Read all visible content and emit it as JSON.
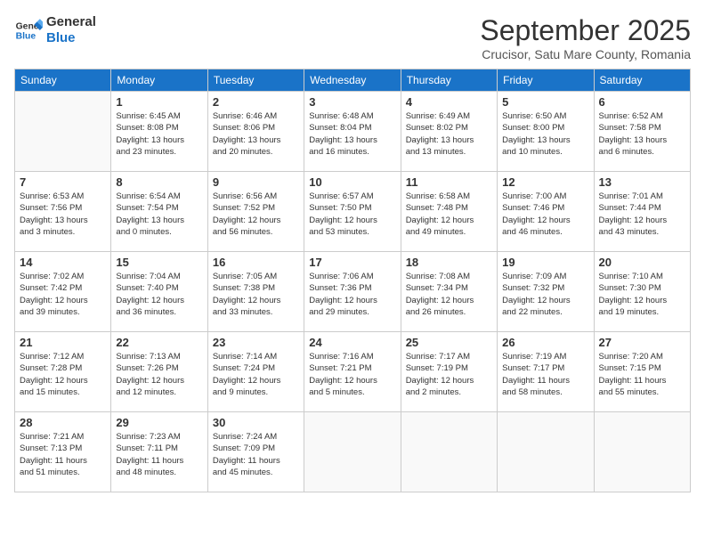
{
  "logo": {
    "line1": "General",
    "line2": "Blue"
  },
  "title": "September 2025",
  "subtitle": "Crucisor, Satu Mare County, Romania",
  "weekdays": [
    "Sunday",
    "Monday",
    "Tuesday",
    "Wednesday",
    "Thursday",
    "Friday",
    "Saturday"
  ],
  "weeks": [
    [
      {
        "day": "",
        "info": ""
      },
      {
        "day": "1",
        "info": "Sunrise: 6:45 AM\nSunset: 8:08 PM\nDaylight: 13 hours\nand 23 minutes."
      },
      {
        "day": "2",
        "info": "Sunrise: 6:46 AM\nSunset: 8:06 PM\nDaylight: 13 hours\nand 20 minutes."
      },
      {
        "day": "3",
        "info": "Sunrise: 6:48 AM\nSunset: 8:04 PM\nDaylight: 13 hours\nand 16 minutes."
      },
      {
        "day": "4",
        "info": "Sunrise: 6:49 AM\nSunset: 8:02 PM\nDaylight: 13 hours\nand 13 minutes."
      },
      {
        "day": "5",
        "info": "Sunrise: 6:50 AM\nSunset: 8:00 PM\nDaylight: 13 hours\nand 10 minutes."
      },
      {
        "day": "6",
        "info": "Sunrise: 6:52 AM\nSunset: 7:58 PM\nDaylight: 13 hours\nand 6 minutes."
      }
    ],
    [
      {
        "day": "7",
        "info": "Sunrise: 6:53 AM\nSunset: 7:56 PM\nDaylight: 13 hours\nand 3 minutes."
      },
      {
        "day": "8",
        "info": "Sunrise: 6:54 AM\nSunset: 7:54 PM\nDaylight: 13 hours\nand 0 minutes."
      },
      {
        "day": "9",
        "info": "Sunrise: 6:56 AM\nSunset: 7:52 PM\nDaylight: 12 hours\nand 56 minutes."
      },
      {
        "day": "10",
        "info": "Sunrise: 6:57 AM\nSunset: 7:50 PM\nDaylight: 12 hours\nand 53 minutes."
      },
      {
        "day": "11",
        "info": "Sunrise: 6:58 AM\nSunset: 7:48 PM\nDaylight: 12 hours\nand 49 minutes."
      },
      {
        "day": "12",
        "info": "Sunrise: 7:00 AM\nSunset: 7:46 PM\nDaylight: 12 hours\nand 46 minutes."
      },
      {
        "day": "13",
        "info": "Sunrise: 7:01 AM\nSunset: 7:44 PM\nDaylight: 12 hours\nand 43 minutes."
      }
    ],
    [
      {
        "day": "14",
        "info": "Sunrise: 7:02 AM\nSunset: 7:42 PM\nDaylight: 12 hours\nand 39 minutes."
      },
      {
        "day": "15",
        "info": "Sunrise: 7:04 AM\nSunset: 7:40 PM\nDaylight: 12 hours\nand 36 minutes."
      },
      {
        "day": "16",
        "info": "Sunrise: 7:05 AM\nSunset: 7:38 PM\nDaylight: 12 hours\nand 33 minutes."
      },
      {
        "day": "17",
        "info": "Sunrise: 7:06 AM\nSunset: 7:36 PM\nDaylight: 12 hours\nand 29 minutes."
      },
      {
        "day": "18",
        "info": "Sunrise: 7:08 AM\nSunset: 7:34 PM\nDaylight: 12 hours\nand 26 minutes."
      },
      {
        "day": "19",
        "info": "Sunrise: 7:09 AM\nSunset: 7:32 PM\nDaylight: 12 hours\nand 22 minutes."
      },
      {
        "day": "20",
        "info": "Sunrise: 7:10 AM\nSunset: 7:30 PM\nDaylight: 12 hours\nand 19 minutes."
      }
    ],
    [
      {
        "day": "21",
        "info": "Sunrise: 7:12 AM\nSunset: 7:28 PM\nDaylight: 12 hours\nand 15 minutes."
      },
      {
        "day": "22",
        "info": "Sunrise: 7:13 AM\nSunset: 7:26 PM\nDaylight: 12 hours\nand 12 minutes."
      },
      {
        "day": "23",
        "info": "Sunrise: 7:14 AM\nSunset: 7:24 PM\nDaylight: 12 hours\nand 9 minutes."
      },
      {
        "day": "24",
        "info": "Sunrise: 7:16 AM\nSunset: 7:21 PM\nDaylight: 12 hours\nand 5 minutes."
      },
      {
        "day": "25",
        "info": "Sunrise: 7:17 AM\nSunset: 7:19 PM\nDaylight: 12 hours\nand 2 minutes."
      },
      {
        "day": "26",
        "info": "Sunrise: 7:19 AM\nSunset: 7:17 PM\nDaylight: 11 hours\nand 58 minutes."
      },
      {
        "day": "27",
        "info": "Sunrise: 7:20 AM\nSunset: 7:15 PM\nDaylight: 11 hours\nand 55 minutes."
      }
    ],
    [
      {
        "day": "28",
        "info": "Sunrise: 7:21 AM\nSunset: 7:13 PM\nDaylight: 11 hours\nand 51 minutes."
      },
      {
        "day": "29",
        "info": "Sunrise: 7:23 AM\nSunset: 7:11 PM\nDaylight: 11 hours\nand 48 minutes."
      },
      {
        "day": "30",
        "info": "Sunrise: 7:24 AM\nSunset: 7:09 PM\nDaylight: 11 hours\nand 45 minutes."
      },
      {
        "day": "",
        "info": ""
      },
      {
        "day": "",
        "info": ""
      },
      {
        "day": "",
        "info": ""
      },
      {
        "day": "",
        "info": ""
      }
    ]
  ]
}
